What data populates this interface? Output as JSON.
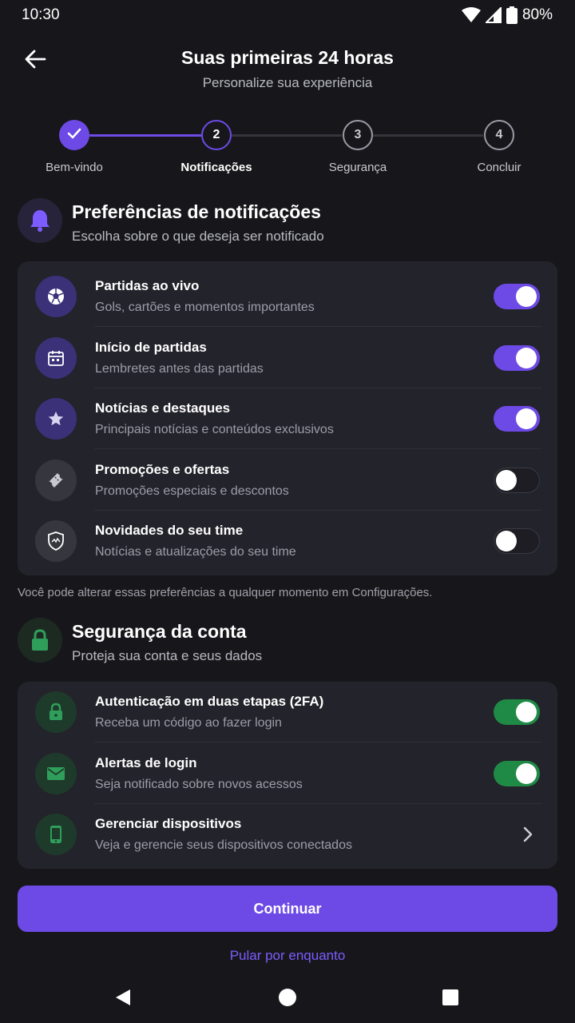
{
  "status_bar": {
    "time": "10:30",
    "battery": "80%"
  },
  "header": {
    "title": "Suas primeiras 24 horas",
    "subtitle": "Personalize sua experiência"
  },
  "stepper": {
    "active_color": "#6d4ae6",
    "steps": [
      {
        "number": "1",
        "label": "Bem-vindo",
        "state": "completed"
      },
      {
        "number": "2",
        "label": "Notificações",
        "state": "current"
      },
      {
        "number": "3",
        "label": "Segurança",
        "state": "pending"
      },
      {
        "number": "4",
        "label": "Concluir",
        "state": "pending"
      }
    ]
  },
  "notifications": {
    "icon": "bell-icon",
    "title": "Preferências de notificações",
    "subtitle": "Escolha sobre o que deseja ser notificado",
    "items": [
      {
        "icon": "soccer-ball-icon",
        "title": "Partidas ao vivo",
        "subtitle": "Gols, cartões e momentos importantes",
        "enabled": true
      },
      {
        "icon": "calendar-icon",
        "title": "Início de partidas",
        "subtitle": "Lembretes antes das partidas",
        "enabled": true
      },
      {
        "icon": "star-icon",
        "title": "Notícias e destaques",
        "subtitle": "Principais notícias e conteúdos exclusivos",
        "enabled": true
      },
      {
        "icon": "ticket-icon",
        "title": "Promoções e ofertas",
        "subtitle": "Promoções especiais e descontos",
        "enabled": false
      },
      {
        "icon": "team-shield-icon",
        "title": "Novidades do seu time",
        "subtitle": "Notícias e atualizações do seu time",
        "enabled": false
      }
    ],
    "footnote": "Você pode alterar essas preferências a qualquer momento em Configurações."
  },
  "security": {
    "icon": "lock-icon",
    "title": "Segurança da conta",
    "subtitle": "Proteja sua conta e seus dados",
    "items": [
      {
        "icon": "lock-icon",
        "title": "Autenticação em duas etapas (2FA)",
        "subtitle": "Receba um código ao fazer login",
        "enabled": true
      },
      {
        "icon": "mail-icon",
        "title": "Alertas de login",
        "subtitle": "Seja notificado sobre novos acessos",
        "enabled": true
      },
      {
        "icon": "phone-icon",
        "title": "Gerenciar dispositivos",
        "subtitle": "Veja e gerencie seus dispositivos conectados",
        "action": "chevron-right-icon"
      }
    ]
  },
  "actions": {
    "continue_label": "Continuar",
    "skip_label": "Pular por enquanto"
  },
  "colors": {
    "background": "#17171b",
    "card": "#23232b",
    "accent_purple": "#6d4ae6",
    "accent_green": "#1f8a45",
    "link": "#7c5cff"
  }
}
